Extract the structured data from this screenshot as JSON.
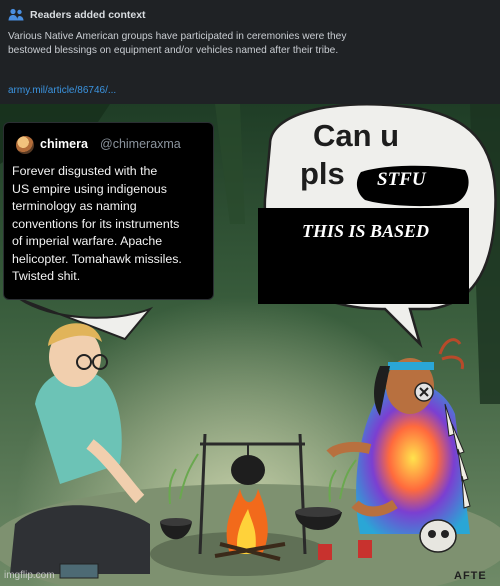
{
  "notes": {
    "title": "Readers added context",
    "body": "Various Native American groups have participated in ceremonies were they bestowed blessings on equipment and/or vehicles named after their tribe.",
    "link": "army.mil/article/86746/..."
  },
  "tweet": {
    "name": "chimera",
    "handle": "@chimeraxma",
    "lines": [
      "Forever disgusted with the",
      "US empire using indigenous",
      "terminology as naming",
      "conventions  for its instruments",
      "of imperial warfare. Apache",
      "helicopter. Tomahawk missiles.",
      "Twisted shit."
    ]
  },
  "bubble": {
    "line1": "Can u",
    "line2": "pls",
    "stfu": "STFU",
    "based": "THIS IS BASED"
  },
  "watermark": "imgflip.com",
  "signature": "AFTE"
}
